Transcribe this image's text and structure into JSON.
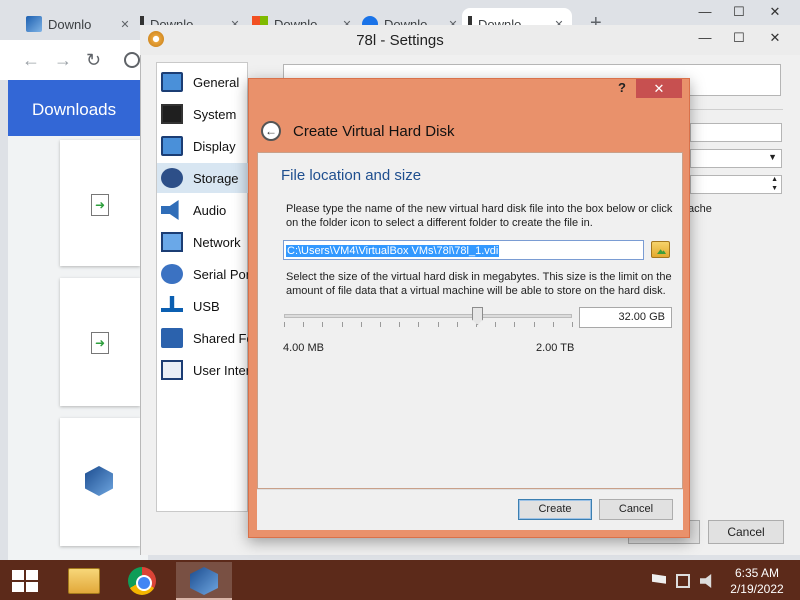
{
  "browser": {
    "tabs": [
      {
        "title": "Downlo",
        "icon": "virtualbox-icon"
      },
      {
        "title": "Downlo",
        "icon": "download-icon"
      },
      {
        "title": "Downlo",
        "icon": "microsoft-icon"
      },
      {
        "title": "Downlo",
        "icon": "globe-icon"
      },
      {
        "title": "Downlo",
        "icon": "download-icon"
      }
    ],
    "close_glyph": "✕",
    "new_tab_glyph": "+",
    "window_controls": {
      "minimize": "—",
      "maximize": "☐",
      "close": "✕"
    },
    "nav": {
      "back": "←",
      "forward": "→",
      "reload": "↻"
    },
    "downloads_title": "Downloads"
  },
  "settings": {
    "title": "78l - Settings",
    "window_controls": {
      "minimize": "—",
      "maximize": "☐",
      "close": "✕"
    },
    "sidebar": [
      {
        "label": "General",
        "icon": "general-icon"
      },
      {
        "label": "System",
        "icon": "system-icon"
      },
      {
        "label": "Display",
        "icon": "display-icon"
      },
      {
        "label": "Storage",
        "icon": "storage-icon",
        "selected": true
      },
      {
        "label": "Audio",
        "icon": "audio-icon"
      },
      {
        "label": "Network",
        "icon": "network-icon"
      },
      {
        "label": "Serial Ports",
        "icon": "serial-ports-icon"
      },
      {
        "label": "USB",
        "icon": "usb-icon"
      },
      {
        "label": "Shared Folders",
        "icon": "shared-folders-icon"
      },
      {
        "label": "User Interface",
        "icon": "user-interface-icon"
      }
    ],
    "partial_text": "ache",
    "spinner_up": "▲",
    "spinner_down": "▼",
    "dropdown_arrow": "▼",
    "cancel_label": "Cancel"
  },
  "dialog": {
    "help": "?",
    "close": "✕",
    "back_glyph": "←",
    "heading": "Create Virtual Hard Disk",
    "section_title": "File location and size",
    "location_instructions": "Please type the name of the new virtual hard disk file into the box below or click on the folder icon to select a different folder to create the file in.",
    "file_path": "C:\\Users\\VM4\\VirtualBox VMs\\78l\\78l_1.vdi",
    "size_instructions": "Select the size of the virtual hard disk in megabytes. This size is the limit on the amount of file data that a virtual machine will be able to store on the hard disk.",
    "size_value": "32.00 GB",
    "size_slider_fraction": 0.67,
    "min_label": "4.00 MB",
    "max_label": "2.00 TB",
    "create_label": "Create",
    "cancel_label": "Cancel"
  },
  "taskbar": {
    "apps": [
      "file-explorer",
      "google-chrome",
      "virtualbox"
    ],
    "active_app": "virtualbox",
    "time": "6:35 AM",
    "date": "2/19/2022"
  },
  "colors": {
    "dialog_frame": "#e9916b",
    "taskbar": "#5c2a1a",
    "downloads_header": "#3367d6",
    "section_title": "#1f4f8f",
    "selection": "#3399ff"
  }
}
